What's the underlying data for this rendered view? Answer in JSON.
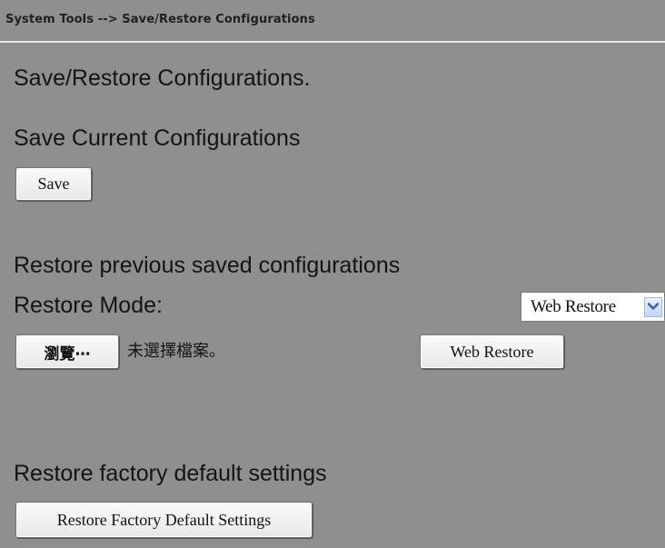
{
  "breadcrumb": "System Tools --> Save/Restore Configurations",
  "page_title": "Save/Restore Configurations.",
  "save_section": {
    "heading": "Save Current Configurations",
    "button_label": "Save"
  },
  "restore_section": {
    "heading": "Restore previous saved configurations",
    "mode_label": "Restore Mode:",
    "mode_selected": "Web Restore",
    "browse_button_label": "瀏覽⋯",
    "file_status": "未選擇檔案。",
    "restore_button_label": "Web Restore"
  },
  "factory_section": {
    "heading": "Restore factory default settings",
    "button_label": "Restore Factory Default Settings"
  },
  "icons": {
    "select_arrow": "chevron-down-icon"
  },
  "colors": {
    "background": "#8f8f8f",
    "divider": "#e5e5e5",
    "arrow_accent": "#3a63b8"
  }
}
